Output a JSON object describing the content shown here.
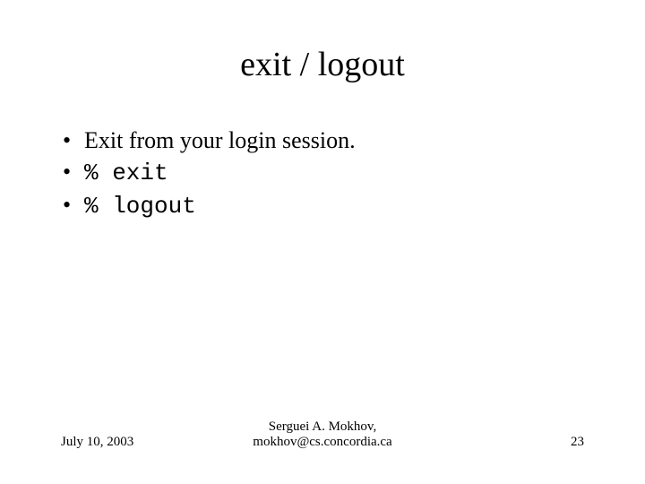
{
  "title": "exit / logout",
  "bullets": [
    {
      "text": "Exit from your login session.",
      "mono": false
    },
    {
      "text": "% exit",
      "mono": true
    },
    {
      "text": "% logout",
      "mono": true
    }
  ],
  "footer": {
    "date": "July 10, 2003",
    "author_line1": "Serguei A. Mokhov,",
    "author_line2": "mokhov@cs.concordia.ca",
    "page": "23"
  }
}
